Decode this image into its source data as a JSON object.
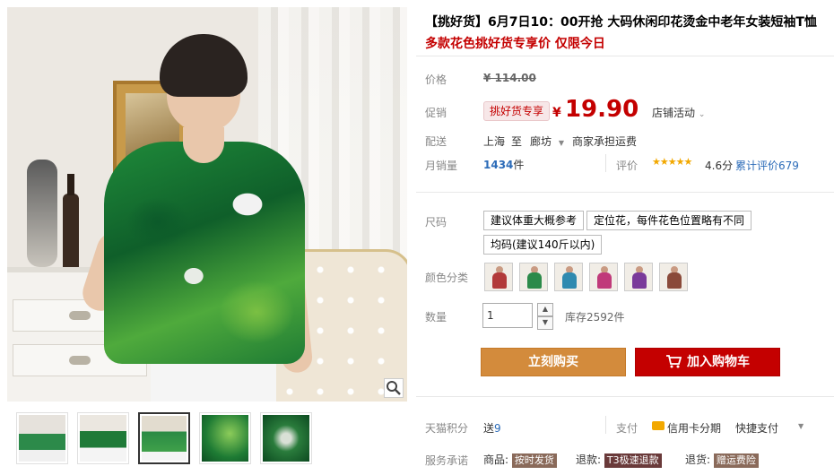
{
  "product": {
    "title": "【挑好货】6月7日10：00开抢 大码休闲印花烫金中老年女装短袖T恤",
    "subtitle": "多款花色挑好货专享价 仅限今日"
  },
  "pricing": {
    "price_label": "价格",
    "original_price": "¥ 114.00",
    "promo_label": "促销",
    "promo_tag": "挑好货专享",
    "currency": "¥",
    "promo_price": "19.90",
    "store_activity": "店铺活动",
    "shipping_label": "配送",
    "ship_from": "上海",
    "ship_to_word": "至",
    "ship_dest": "廊坊",
    "shipping_fee": "商家承担运费",
    "monthly_sales_label": "月销量",
    "monthly_sales_value": "1434",
    "monthly_sales_unit": "件",
    "rating_label": "评价",
    "rating_stars": "★★★★★",
    "rating_score": "4.6分",
    "review_count_text": "累计评价679"
  },
  "options": {
    "size_label": "尺码",
    "size_options": [
      "建议体重大概参考",
      "定位花，每件花色位置略有不同",
      "均码(建议140斤以内)"
    ],
    "color_label": "颜色分类",
    "color_swatch_colors": [
      "#b23a3a",
      "#2c8a4a",
      "#2f8ab0",
      "#c03a7a",
      "#7a3a9a",
      "#8a4a3a"
    ],
    "qty_label": "数量",
    "qty_value": "1",
    "stock": "库存2592件"
  },
  "actions": {
    "buy_now": "立刻购买",
    "add_to_cart": "加入购物车",
    "cart_icon": "cart-icon"
  },
  "footer": {
    "points_label": "天猫积分",
    "points_text": "送",
    "points_value": "9",
    "pay_label": "支付",
    "credit_text": "信用卡分期",
    "quick_pay": "快捷支付",
    "service_label": "服务承诺",
    "goods_label": "商品:",
    "goods_badge": "按时发货",
    "return_label": "退款:",
    "return_badge": "T3极速退款",
    "return_goods_label": "退货:",
    "return_goods_badge": "赠运费险"
  },
  "colors": {
    "brand_red": "#c40000",
    "buy_orange": "#d38b3c",
    "sales_blue": "#2b6bb8",
    "star_gold": "#f2a800"
  }
}
